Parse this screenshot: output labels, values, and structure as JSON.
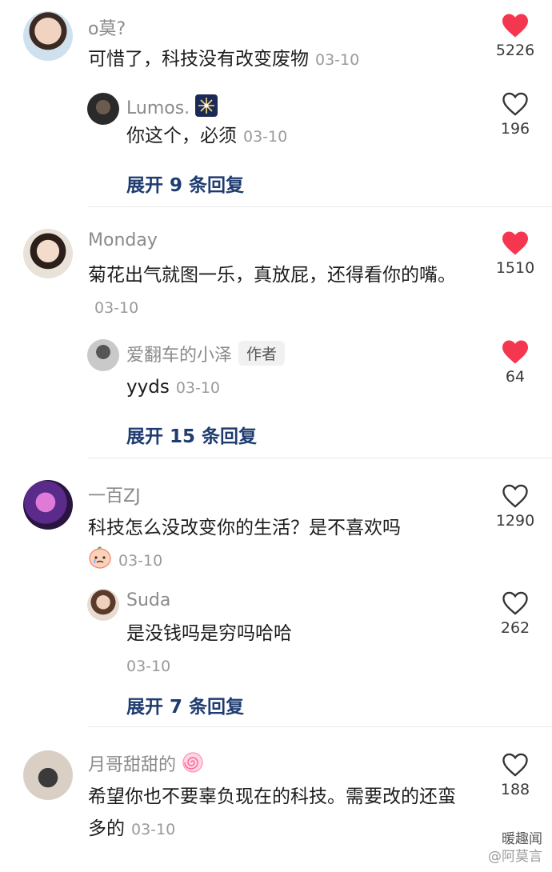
{
  "threads": [
    {
      "comment": {
        "author": "o莫?",
        "text": "可惜了，科技没有改变废物",
        "date": "03-10",
        "likes": "5226",
        "liked": true
      },
      "reply": {
        "author": "Lumos.",
        "author_emoji": "sparkler-icon",
        "text": "你这个，必须",
        "date": "03-10",
        "likes": "196",
        "liked": false
      },
      "expand_label": "展开 9 条回复"
    },
    {
      "comment": {
        "author": "Monday",
        "text": "菊花出气就图一乐，真放屁，还得看你的嘴。",
        "date": "03-10",
        "likes": "1510",
        "liked": true
      },
      "reply": {
        "author": "爱翻车的小泽",
        "badge": "作者",
        "text": "yyds",
        "date": "03-10",
        "likes": "64",
        "liked": true
      },
      "expand_label": "展开 15 条回复"
    },
    {
      "comment": {
        "author": "一百ZJ",
        "text": "科技怎么没改变你的生活？是不喜欢吗",
        "emoji": "crying-peach-face-icon",
        "date": "03-10",
        "likes": "1290",
        "liked": false
      },
      "reply": {
        "author": "Suda",
        "text": "是没钱吗是穷吗哈哈",
        "date": "03-10",
        "likes": "262",
        "liked": false
      },
      "expand_label": "展开 7 条回复"
    },
    {
      "comment": {
        "author": "月哥甜甜的",
        "author_emoji": "swirl-candy-icon",
        "text": "希望你也不要辜负现在的科技。需要改的还蛮多的",
        "date": "03-10",
        "likes": "188",
        "liked": false
      }
    }
  ],
  "watermark": {
    "line1": "暖趣闻",
    "line2": "@阿莫言"
  },
  "colors": {
    "liked_heart": "#f5364f",
    "outline_heart": "#333333",
    "expand_link": "#1f3c70"
  }
}
